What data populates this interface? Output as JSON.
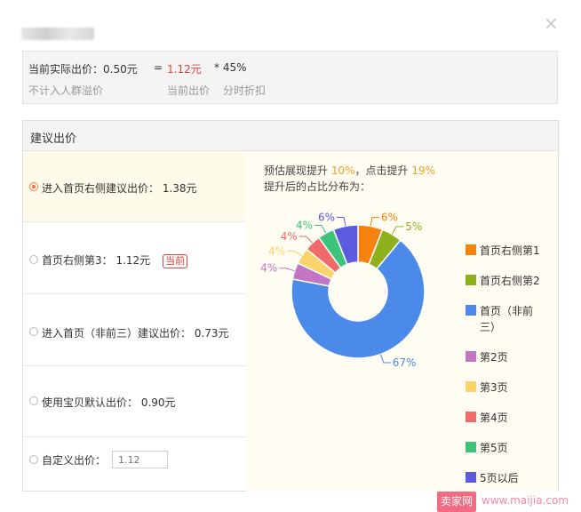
{
  "dialog": {
    "close_symbol": "×",
    "close_icon": "close-icon"
  },
  "top": {
    "line1_label": "当前实际出价：0.50元",
    "equals": "=",
    "current_value": "1.12元",
    "multiplier": "* 45%",
    "note1": "不计入人群溢价",
    "note2": "当前出价",
    "note3": "分时折扣"
  },
  "section": {
    "title": "建议出价"
  },
  "options": [
    {
      "label": "进入首页右侧建议出价：  1.38元",
      "selected": true
    },
    {
      "label": "首页右侧第3：  1.12元",
      "badge": "当前",
      "selected": false
    },
    {
      "label": "进入首页（非前三）建议出价：  0.73元",
      "selected": false
    },
    {
      "label": "使用宝贝默认出价：  0.90元",
      "selected": false
    },
    {
      "label": "自定义出价：",
      "input_placeholder": "1.12",
      "selected": false
    }
  ],
  "prediction": {
    "prefix": "预估展现提升 ",
    "show_up": "10%",
    "mid": "，点击提升 ",
    "click_up": "19%",
    "line2": "提升后的占比分布为："
  },
  "chart_data": {
    "type": "pie",
    "donut": true,
    "title": "",
    "legend_position": "right",
    "slices": [
      {
        "name": "首页右侧第1",
        "value": 6,
        "label": "6%",
        "color": "#f5820e"
      },
      {
        "name": "首页右侧第2",
        "value": 5,
        "label": "5%",
        "color": "#8db01c"
      },
      {
        "name": "首页（非前三）",
        "value": 67,
        "label": "67%",
        "color": "#4b8ae8"
      },
      {
        "name": "第2页",
        "value": 4,
        "label": "4%",
        "color": "#c275c2"
      },
      {
        "name": "第3页",
        "value": 4,
        "label": "4%",
        "color": "#fad36a"
      },
      {
        "name": "第4页",
        "value": 4,
        "label": "4%",
        "color": "#f06a6a"
      },
      {
        "name": "第5页",
        "value": 4,
        "label": "4%",
        "color": "#3dc47a"
      },
      {
        "name": "5页以后",
        "value": 6,
        "label": "6%",
        "color": "#5b5be0"
      }
    ]
  },
  "legend": [
    {
      "line1": "首页右侧第1",
      "line2": ""
    },
    {
      "line1": "首页右侧第2",
      "line2": ""
    },
    {
      "line1": "首页（非前",
      "line2": "三）"
    },
    {
      "line1": "第2页",
      "line2": ""
    },
    {
      "line1": "第3页",
      "line2": ""
    },
    {
      "line1": "第4页",
      "line2": ""
    },
    {
      "line1": "第5页",
      "line2": ""
    },
    {
      "line1": "5页以后",
      "line2": ""
    }
  ],
  "watermark": {
    "brand": "卖家网",
    "url": "www.maijia.com"
  }
}
